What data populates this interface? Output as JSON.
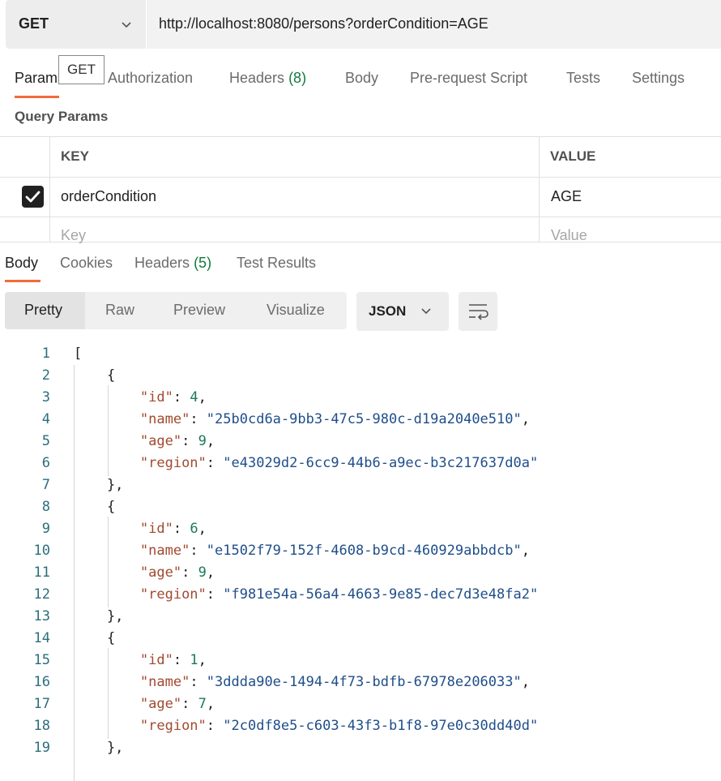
{
  "request": {
    "method": "GET",
    "url": "http://localhost:8080/persons?orderCondition=AGE"
  },
  "request_tabs": [
    {
      "label": "Param",
      "active": true
    },
    {
      "label": "Authorization"
    },
    {
      "label": "Headers",
      "count": "(8)"
    },
    {
      "label": "Body"
    },
    {
      "label": "Pre-request Script"
    },
    {
      "label": "Tests"
    },
    {
      "label": "Settings"
    }
  ],
  "tooltip": "GET",
  "query_params": {
    "title": "Query Params",
    "headers": {
      "key": "KEY",
      "value": "VALUE"
    },
    "rows": [
      {
        "checked": true,
        "key": "orderCondition",
        "value": "AGE"
      }
    ],
    "placeholder": {
      "key": "Key",
      "value": "Value"
    }
  },
  "response_tabs": [
    {
      "label": "Body",
      "active": true
    },
    {
      "label": "Cookies"
    },
    {
      "label": "Headers",
      "count": "(5)"
    },
    {
      "label": "Test Results"
    }
  ],
  "view_modes": [
    "Pretty",
    "Raw",
    "Preview",
    "Visualize"
  ],
  "active_view": "Pretty",
  "format": "JSON",
  "icons": {
    "method_dropdown": "chevron-down-icon",
    "format_dropdown": "chevron-down-icon",
    "wrap": "wrap-lines-icon",
    "checkbox": "check-icon"
  },
  "colors": {
    "accent": "#f26b3a",
    "count": "#0f7b3c",
    "json_key": "#a14a2f",
    "json_string": "#1f4e89",
    "json_number": "#1a7a55"
  },
  "response_body": [
    {
      "id": "4",
      "name": "25b0cd6a-9bb3-47c5-980c-d19a2040e510",
      "age": "9",
      "region": "e43029d2-6cc9-44b6-a9ec-b3c217637d0a"
    },
    {
      "id": "6",
      "name": "e1502f79-152f-4608-b9cd-460929abbdcb",
      "age": "9",
      "region": "f981e54a-56a4-4663-9e85-dec7d3e48fa2"
    },
    {
      "id": "1",
      "name": "3ddda90e-1494-4f73-bdfb-67978e206033",
      "age": "7",
      "region": "2c0df8e5-c603-43f3-b1f8-97e0c30dd40d"
    }
  ]
}
